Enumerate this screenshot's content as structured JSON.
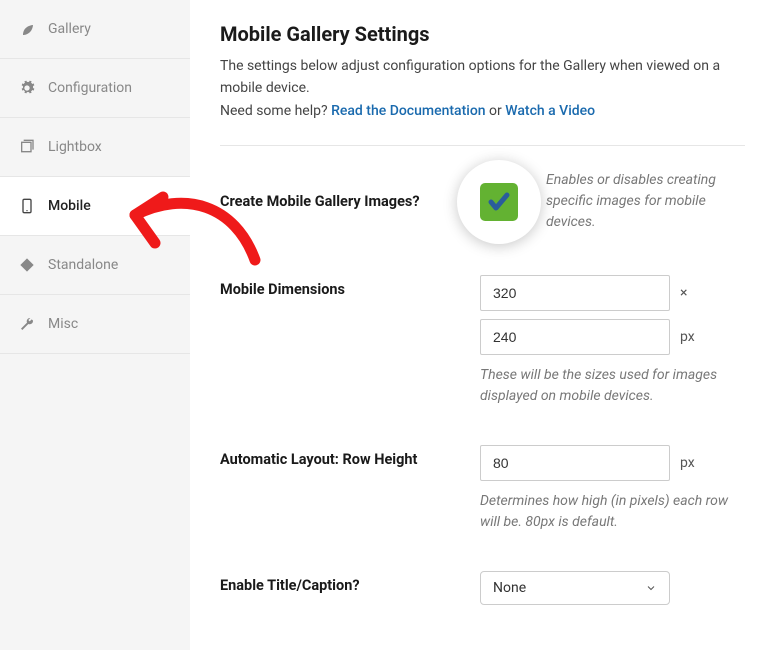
{
  "sidebar": {
    "items": [
      {
        "label": "Gallery"
      },
      {
        "label": "Configuration"
      },
      {
        "label": "Lightbox"
      },
      {
        "label": "Mobile"
      },
      {
        "label": "Standalone"
      },
      {
        "label": "Misc"
      }
    ]
  },
  "header": {
    "title": "Mobile Gallery Settings",
    "desc": "The settings below adjust configuration options for the Gallery when viewed on a mobile device.",
    "help_prefix": "Need some help? ",
    "doc_link": "Read the Documentation",
    "help_or": " or ",
    "video_link": "Watch a Video"
  },
  "fields": {
    "create_images": {
      "label": "Create Mobile Gallery Images?",
      "hint": "Enables or disables creating specific images for mobile devices.",
      "checked": true
    },
    "dimensions": {
      "label": "Mobile Dimensions",
      "width": "320",
      "height": "240",
      "sep": "×",
      "unit": "px",
      "hint": "These will be the sizes used for images displayed on mobile devices."
    },
    "row_height": {
      "label": "Automatic Layout: Row Height",
      "value": "80",
      "unit": "px",
      "hint": "Determines how high (in pixels) each row will be. 80px is default."
    },
    "title_caption": {
      "label": "Enable Title/Caption?",
      "selected": "None"
    }
  }
}
